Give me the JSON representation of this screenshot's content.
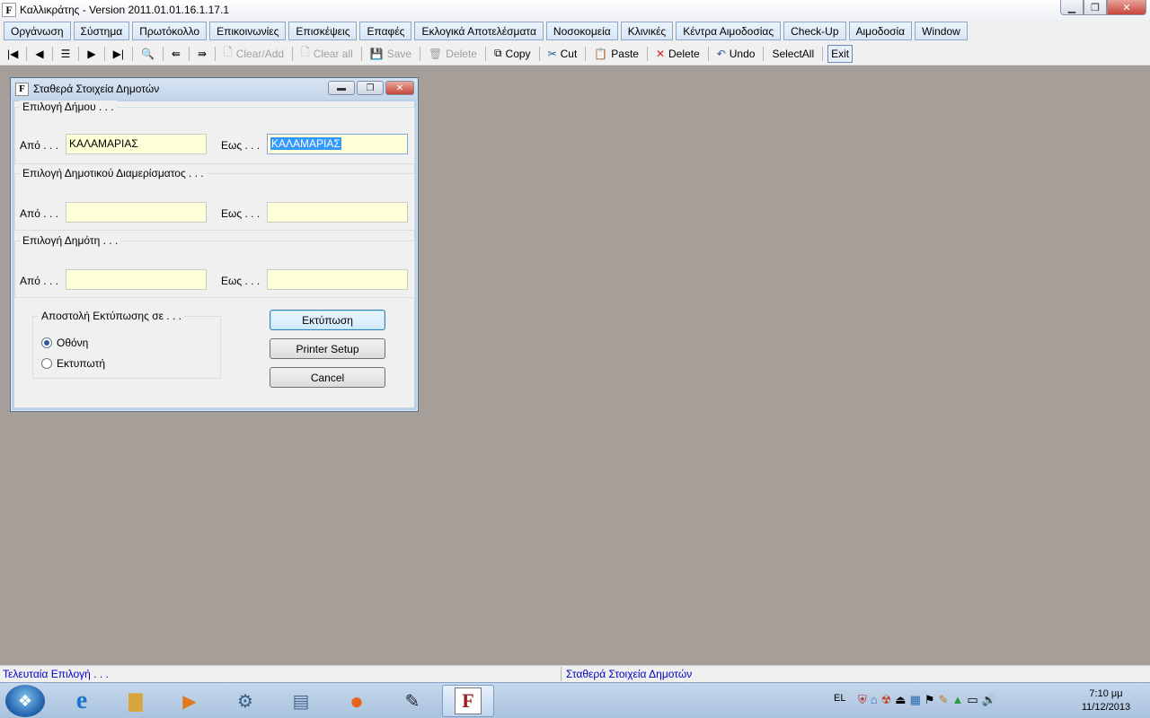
{
  "window": {
    "icon_letter": "F",
    "title": "Καλλικράτης - Version 2011.01.01.16.1.17.1",
    "controls": {
      "minimize": "▁",
      "restore": "❐",
      "close": "✕"
    }
  },
  "menu": [
    "Οργάνωση",
    "Σύστημα",
    "Πρωτόκολλο",
    "Επικοινωνίες",
    "Επισκέψεις",
    "Επαφές",
    "Εκλογικά Αποτελέσματα",
    "Νοσοκομεία",
    "Κλινικές",
    "Κέντρα Αιμοδοσίας",
    "Check-Up",
    "Αιμοδοσία",
    "Window"
  ],
  "toolbar": {
    "first": "|◀",
    "prev": "◀",
    "list": "☰",
    "next": "▶",
    "last": "▶|",
    "find": "🔍",
    "back_all": "⇚",
    "fwd_all": "⇛",
    "clear_add": "Clear/Add",
    "clear_all": "Clear all",
    "save": "Save",
    "delete_rec": "Delete",
    "copy": "Copy",
    "cut": "Cut",
    "paste": "Paste",
    "delete": "Delete",
    "undo": "Undo",
    "select_all": "SelectAll",
    "exit": "Exit"
  },
  "dialog": {
    "icon_letter": "F",
    "title": "Σταθερά Στοιχεία Δημοτών",
    "controls": {
      "minimize": "▬",
      "restore": "❐",
      "close": "✕"
    },
    "groups": [
      {
        "legend": "Επιλογή Δήμου . . .",
        "from_label": "Από . . .",
        "from_value": "ΚΑΛΑΜΑΡΙΑΣ",
        "to_label": "Εως . . .",
        "to_value": "ΚΑΛΑΜΑΡΙΑΣ"
      },
      {
        "legend": "Επιλογή Δημοτικού Διαμερίσματος . . .",
        "from_label": "Από . . .",
        "from_value": "",
        "to_label": "Εως . . .",
        "to_value": ""
      },
      {
        "legend": "Επιλογή Δημότη . . .",
        "from_label": "Από . . .",
        "from_value": "",
        "to_label": "Εως . . .",
        "to_value": ""
      }
    ],
    "print_target": {
      "legend": "Αποστολή Εκτύπωσης σε . . .",
      "options": [
        "Οθόνη",
        "Εκτυπωτή"
      ],
      "selected": "Οθόνη"
    },
    "buttons": {
      "print": "Εκτύπωση",
      "printer_setup": "Printer Setup",
      "cancel": "Cancel"
    }
  },
  "status": {
    "left": "Τελευταία Επιλογή . . .",
    "right": "Σταθερά Στοιχεία Δημοτών"
  },
  "taskbar": {
    "language": "EL",
    "time": "7:10 μμ",
    "date": "11/12/2013",
    "active_app_letter": "F"
  },
  "colors": {
    "desktop": "#a69e98",
    "field_bg": "#ffffd8",
    "status_text": "#0000c8"
  }
}
